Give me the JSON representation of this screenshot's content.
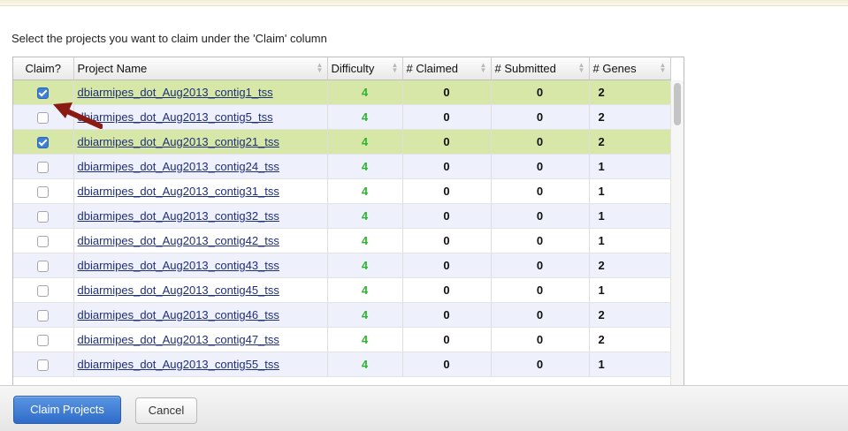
{
  "instruction": "Select the projects you want to claim under the 'Claim' column",
  "table": {
    "headers": [
      "Claim?",
      "Project Name",
      "Difficulty",
      "# Claimed",
      "# Submitted",
      "# Genes"
    ],
    "rows": [
      {
        "checked": true,
        "project": "dbiarmipes_dot_Aug2013_contig1_tss",
        "difficulty": "4",
        "claimed": "0",
        "submitted": "0",
        "genes": "2"
      },
      {
        "checked": false,
        "project": "dbiarmipes_dot_Aug2013_contig5_tss",
        "difficulty": "4",
        "claimed": "0",
        "submitted": "0",
        "genes": "2"
      },
      {
        "checked": true,
        "project": "dbiarmipes_dot_Aug2013_contig21_tss",
        "difficulty": "4",
        "claimed": "0",
        "submitted": "0",
        "genes": "2"
      },
      {
        "checked": false,
        "project": "dbiarmipes_dot_Aug2013_contig24_tss",
        "difficulty": "4",
        "claimed": "0",
        "submitted": "0",
        "genes": "1"
      },
      {
        "checked": false,
        "project": "dbiarmipes_dot_Aug2013_contig31_tss",
        "difficulty": "4",
        "claimed": "0",
        "submitted": "0",
        "genes": "1"
      },
      {
        "checked": false,
        "project": "dbiarmipes_dot_Aug2013_contig32_tss",
        "difficulty": "4",
        "claimed": "0",
        "submitted": "0",
        "genes": "1"
      },
      {
        "checked": false,
        "project": "dbiarmipes_dot_Aug2013_contig42_tss",
        "difficulty": "4",
        "claimed": "0",
        "submitted": "0",
        "genes": "1"
      },
      {
        "checked": false,
        "project": "dbiarmipes_dot_Aug2013_contig43_tss",
        "difficulty": "4",
        "claimed": "0",
        "submitted": "0",
        "genes": "2"
      },
      {
        "checked": false,
        "project": "dbiarmipes_dot_Aug2013_contig45_tss",
        "difficulty": "4",
        "claimed": "0",
        "submitted": "0",
        "genes": "1"
      },
      {
        "checked": false,
        "project": "dbiarmipes_dot_Aug2013_contig46_tss",
        "difficulty": "4",
        "claimed": "0",
        "submitted": "0",
        "genes": "2"
      },
      {
        "checked": false,
        "project": "dbiarmipes_dot_Aug2013_contig47_tss",
        "difficulty": "4",
        "claimed": "0",
        "submitted": "0",
        "genes": "2"
      },
      {
        "checked": false,
        "project": "dbiarmipes_dot_Aug2013_contig55_tss",
        "difficulty": "4",
        "claimed": "0",
        "submitted": "0",
        "genes": "1"
      }
    ]
  },
  "buttons": {
    "claim": "Claim Projects",
    "cancel": "Cancel"
  },
  "icons": {
    "sort": "sort-icon",
    "arrow": "arrow-annotation-icon"
  },
  "colors": {
    "selected_row": "#d6e7a8",
    "alt_row": "#eef0fb",
    "difficulty": "#2cb52c",
    "primary_button": "#3a78d4",
    "arrow": "#8b1a12"
  }
}
